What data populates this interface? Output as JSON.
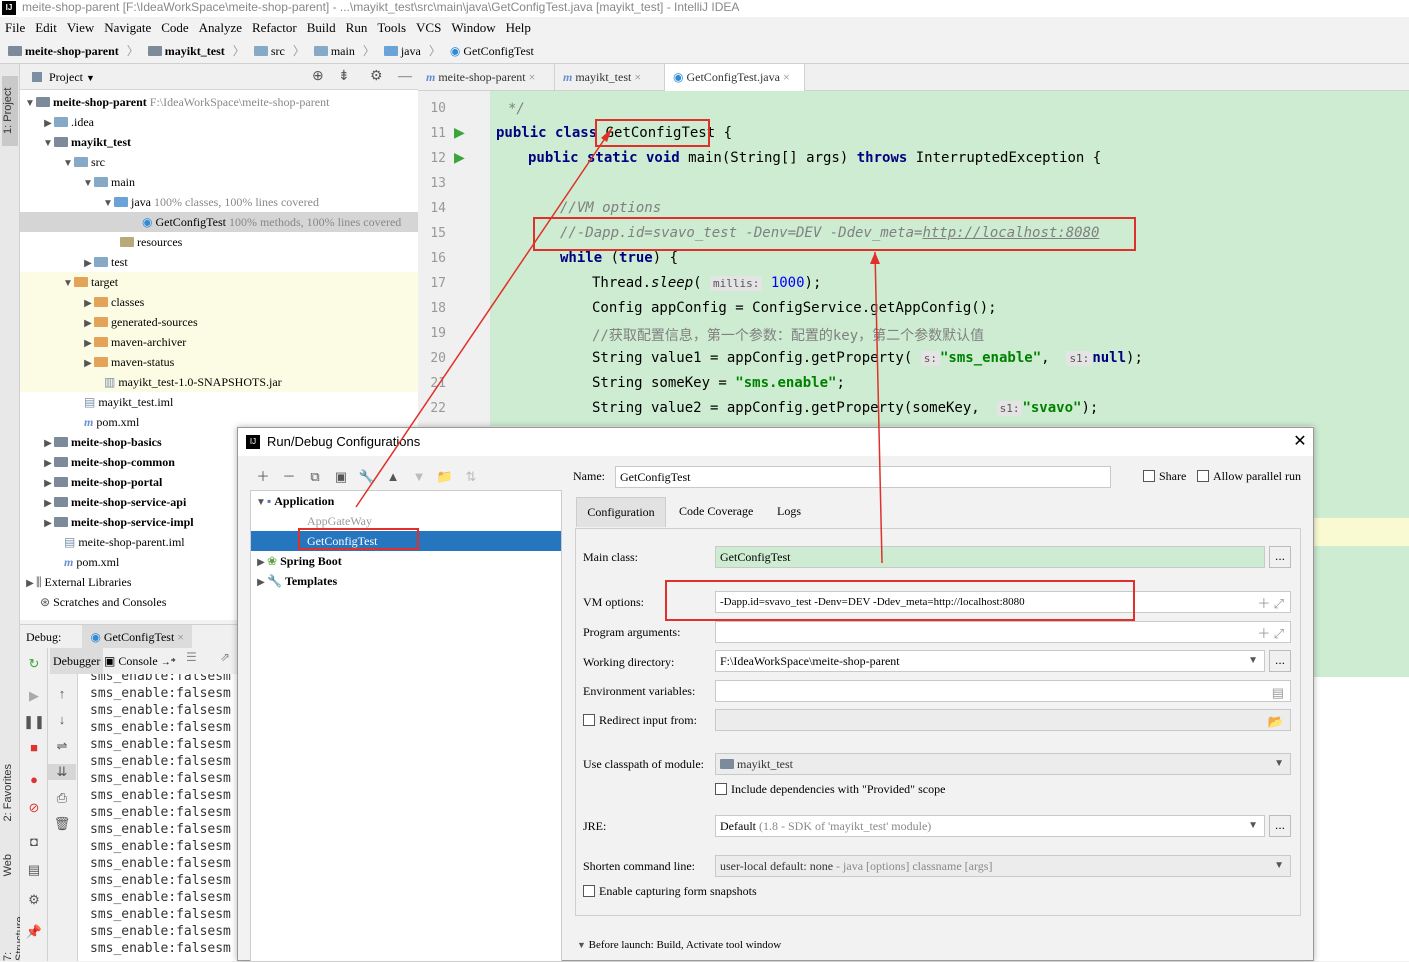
{
  "window": {
    "title": "meite-shop-parent [F:\\IdeaWorkSpace\\meite-shop-parent] - ...\\mayikt_test\\src\\main\\java\\GetConfigTest.java [mayikt_test] - IntelliJ IDEA"
  },
  "menu": [
    "File",
    "Edit",
    "View",
    "Navigate",
    "Code",
    "Analyze",
    "Refactor",
    "Build",
    "Run",
    "Tools",
    "VCS",
    "Window",
    "Help"
  ],
  "breadcrumb": [
    "meite-shop-parent",
    "mayikt_test",
    "src",
    "main",
    "java",
    "GetConfigTest"
  ],
  "left_strip": {
    "project": "1: Project",
    "favorites": "2: Favorites",
    "web": "Web",
    "structure": "7: Structure"
  },
  "project_panel": {
    "title": "Project",
    "tree": [
      {
        "label": "meite-shop-parent",
        "extra": "F:\\IdeaWorkSpace\\meite-shop-parent"
      },
      {
        "label": ".idea",
        "extra": ""
      },
      {
        "label": "mayikt_test",
        "extra": ""
      },
      {
        "label": "src",
        "extra": ""
      },
      {
        "label": "main",
        "extra": ""
      },
      {
        "label": "java",
        "extra": "100% classes, 100% lines covered"
      },
      {
        "label": "GetConfigTest",
        "extra": "100% methods, 100% lines covered"
      },
      {
        "label": "resources",
        "extra": ""
      },
      {
        "label": "test",
        "extra": ""
      },
      {
        "label": "target",
        "extra": ""
      },
      {
        "label": "classes",
        "extra": ""
      },
      {
        "label": "generated-sources",
        "extra": ""
      },
      {
        "label": "maven-archiver",
        "extra": ""
      },
      {
        "label": "maven-status",
        "extra": ""
      },
      {
        "label": "mayikt_test-1.0-SNAPSHOTS.jar",
        "extra": ""
      },
      {
        "label": "mayikt_test.iml",
        "extra": ""
      },
      {
        "label": "pom.xml",
        "extra": ""
      },
      {
        "label": "meite-shop-basics",
        "extra": ""
      },
      {
        "label": "meite-shop-common",
        "extra": ""
      },
      {
        "label": "meite-shop-portal",
        "extra": ""
      },
      {
        "label": "meite-shop-service-api",
        "extra": ""
      },
      {
        "label": "meite-shop-service-impl",
        "extra": ""
      },
      {
        "label": "meite-shop-parent.iml",
        "extra": ""
      },
      {
        "label": "pom.xml",
        "extra": ""
      },
      {
        "label": "External Libraries",
        "extra": ""
      },
      {
        "label": "Scratches and Consoles",
        "extra": ""
      }
    ]
  },
  "editor": {
    "tabs": [
      "meite-shop-parent",
      "mayikt_test",
      "GetConfigTest.java"
    ],
    "line_numbers": [
      "10",
      "11",
      "12",
      "13",
      "14",
      "15",
      "16",
      "17",
      "18",
      "19",
      "20",
      "21",
      "22"
    ],
    "code": {
      "l10": "*/",
      "l11_kw": "public class",
      "l11_name": "GetConfigTest",
      "l11_rest": " {",
      "l12_kw": "public static void",
      "l12_sig": " main(String[] args) ",
      "l12_throws": "throws",
      "l12_rest": " InterruptedException {",
      "l14": "//VM options",
      "l15_a": "//-Dapp.id=svavo_test -Denv=DEV -Ddev_meta=",
      "l15_url": "http://localhost:8080",
      "l16_kw": "while",
      "l16_a": " (",
      "l16_true": "true",
      "l16_b": ") {",
      "l17_a": "Thread.",
      "l17_sleep": "sleep",
      "l17_b": "( ",
      "l17_hint": "millis:",
      "l17_num": "1000",
      "l17_c": ");",
      "l18": "Config appConfig = ConfigService.getAppConfig();",
      "l19": "//获取配置信息，第一个参数：配置的key，第二个参数默认值",
      "l20_a": "String value1 = appConfig.getProperty( ",
      "l20_hint1": "s:",
      "l20_str": "\"sms_enable\"",
      "l20_b": ",  ",
      "l20_hint2": "s1:",
      "l20_null": "null",
      "l20_c": ");",
      "l21_a": "String someKey = ",
      "l21_str": "\"sms.enable\"",
      "l21_b": ";",
      "l22_a": "String value2 = appConfig.getProperty(someKey,  ",
      "l22_hint": "s1:",
      "l22_str": "\"svavo\"",
      "l22_b": ");"
    }
  },
  "debug": {
    "label": "Debug:",
    "tab": "GetConfigTest",
    "debugger_tab": "Debugger",
    "console_tab": "Console",
    "console_lines": [
      "sms_enable:falsesm",
      "sms_enable:falsesm",
      "sms_enable:falsesm",
      "sms_enable:falsesm",
      "sms_enable:falsesm",
      "sms_enable:falsesm",
      "sms_enable:falsesm",
      "sms_enable:falsesm",
      "sms_enable:falsesm",
      "sms_enable:falsesm",
      "sms_enable:falsesm",
      "sms_enable:falsesm",
      "sms_enable:falsesm",
      "sms_enable:falsesm",
      "sms_enable:falsesm",
      "sms_enable:falsesm",
      "sms_enable:falsesm"
    ]
  },
  "dialog": {
    "title": "Run/Debug Configurations",
    "tree": {
      "application": "Application",
      "appgateway": "AppGateWay",
      "getconfigtest": "GetConfigTest",
      "spring_boot": "Spring Boot",
      "templates": "Templates"
    },
    "name_label": "Name:",
    "name_value": "GetConfigTest",
    "share_label": "Share",
    "parallel_label": "Allow parallel run",
    "tabs": [
      "Configuration",
      "Code Coverage",
      "Logs"
    ],
    "main_class_label": "Main class:",
    "main_class_value": "GetConfigTest",
    "vm_options_label": "VM options:",
    "vm_options_value": "-Dapp.id=svavo_test -Denv=DEV -Ddev_meta=http://localhost:8080",
    "program_args_label": "Program arguments:",
    "program_args_value": "",
    "working_dir_label": "Working directory:",
    "working_dir_value": "F:\\IdeaWorkSpace\\meite-shop-parent",
    "env_vars_label": "Environment variables:",
    "env_vars_value": "",
    "redirect_label": "Redirect input from:",
    "classpath_label": "Use classpath of module:",
    "classpath_value": "mayikt_test",
    "include_deps_label": "Include dependencies with \"Provided\" scope",
    "jre_label": "JRE:",
    "jre_value": "Default",
    "jre_detail": "(1.8 - SDK of 'mayikt_test' module)",
    "shorten_label": "Shorten command line:",
    "shorten_value": "user-local default: none",
    "shorten_detail": " - java [options] classname [args]",
    "snapshots_label": "Enable capturing form snapshots",
    "before_launch": "Before launch: Build, Activate tool window"
  },
  "colors": {
    "annotation_red": "#e0302a",
    "selection_blue": "#2675bf",
    "editor_green": "#cdecd1"
  }
}
